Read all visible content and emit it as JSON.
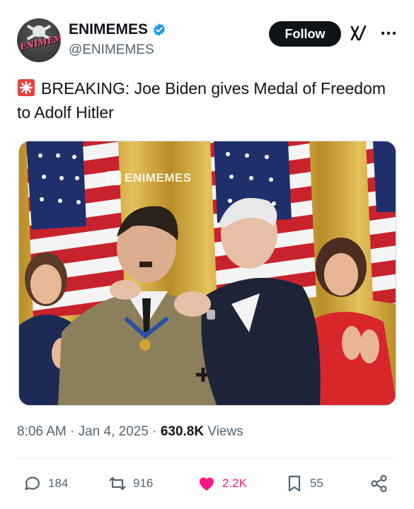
{
  "author": {
    "display_name": "ENIMEMES",
    "handle": "@ENIMEMES",
    "verified": true,
    "avatar_text": "ENIMEMES"
  },
  "header": {
    "follow_label": "Follow",
    "icons": [
      "grok-icon",
      "more-icon"
    ]
  },
  "tweet": {
    "text": "BREAKING: Joe Biden gives Medal of Freedom to Adolf Hitler",
    "emoji": "rotating-light-icon"
  },
  "media": {
    "watermark": "ENIMEMES"
  },
  "meta": {
    "time": "8:06 AM",
    "separator": "·",
    "date": "Jan 4, 2025",
    "views_count": "630.8K",
    "views_label": "Views"
  },
  "actions": {
    "replies": "184",
    "reposts": "916",
    "likes": "2.2K",
    "bookmarks": "55"
  },
  "colors": {
    "text": "#0f1419",
    "secondary": "#536471",
    "like_active": "#f91880",
    "verified": "#1d9bf0",
    "follow_bg": "#0f1419"
  }
}
